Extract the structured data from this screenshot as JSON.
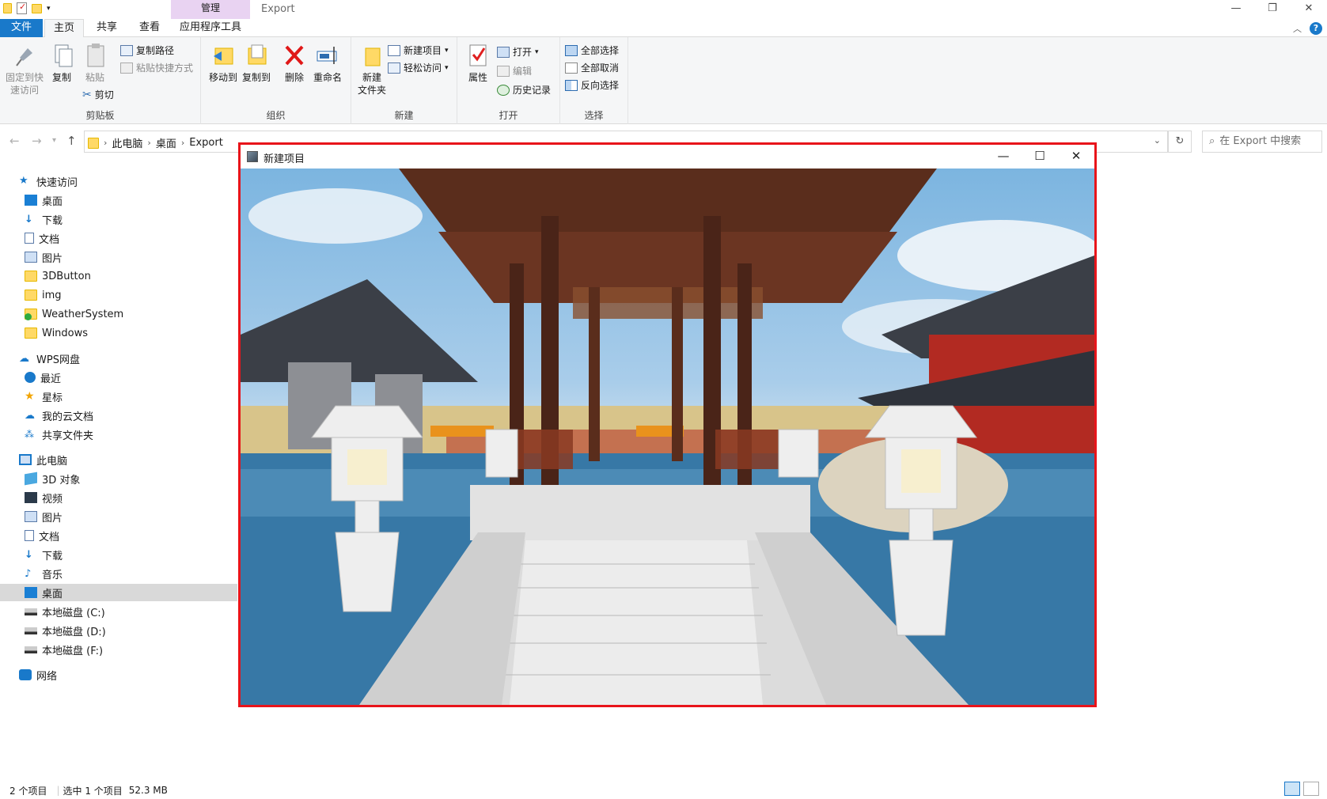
{
  "window": {
    "title": "Export",
    "context_tab": "管理",
    "controls": [
      "—",
      "❐",
      "✕"
    ]
  },
  "ribbon_tabs": [
    "文件",
    "主页",
    "共享",
    "查看",
    "应用程序工具"
  ],
  "ribbon": {
    "clipboard": {
      "label": "剪贴板",
      "pin": "固定到快\n速访问",
      "copy": "复制",
      "paste": "粘贴",
      "copy_path": "复制路径",
      "paste_shortcut": "粘贴快捷方式",
      "cut": "剪切"
    },
    "organize": {
      "label": "组织",
      "move_to": "移动到",
      "copy_to": "复制到",
      "delete": "删除",
      "rename": "重命名"
    },
    "new": {
      "label": "新建",
      "new_folder": "新建\n文件夹",
      "new_item": "新建项目",
      "easy_access": "轻松访问"
    },
    "open": {
      "label": "打开",
      "properties": "属性",
      "open": "打开",
      "edit": "编辑",
      "history": "历史记录"
    },
    "select": {
      "label": "选择",
      "select_all": "全部选择",
      "select_none": "全部取消",
      "invert": "反向选择"
    }
  },
  "address": {
    "crumbs": [
      "此电脑",
      "桌面",
      "Export"
    ],
    "search_placeholder": "在 Export 中搜索"
  },
  "nav": {
    "quick_access": "快速访问",
    "quick_items": [
      "桌面",
      "下载",
      "文档",
      "图片",
      "3DButton",
      "img",
      "WeatherSystem",
      "Windows"
    ],
    "wps": "WPS网盘",
    "wps_items": [
      "最近",
      "星标",
      "我的云文档",
      "共享文件夹"
    ],
    "this_pc": "此电脑",
    "pc_items": [
      "3D 对象",
      "视频",
      "图片",
      "文档",
      "下载",
      "音乐",
      "桌面",
      "本地磁盘 (C:)",
      "本地磁盘 (D:)",
      "本地磁盘 (F:)"
    ],
    "network": "网络"
  },
  "status": {
    "count": "2 个项目",
    "selection": "选中 1 个项目",
    "size": "52.3 MB"
  },
  "app_window": {
    "title": "新建项目"
  }
}
